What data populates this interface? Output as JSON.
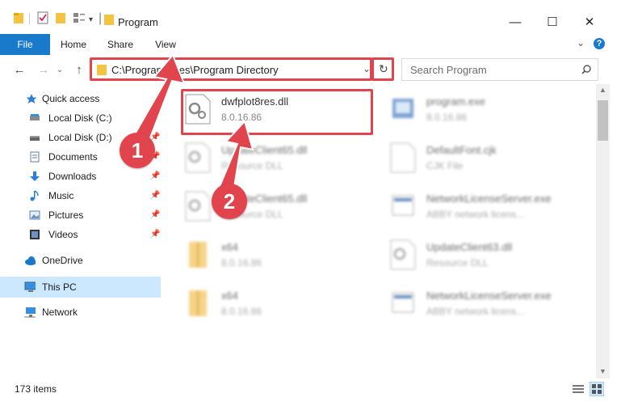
{
  "window": {
    "title": "Program",
    "minimize": "—",
    "maximize": "☐",
    "close": "✕"
  },
  "ribbon": {
    "tabs": [
      "File",
      "Home",
      "Share",
      "View"
    ]
  },
  "address": {
    "path": "C:\\Program Files\\Program Directory",
    "search_placeholder": "Search Program"
  },
  "sidebar": {
    "items": [
      {
        "label": "Quick access",
        "icon": "star-icon",
        "pinned": false
      },
      {
        "label": "Local Disk (C:)",
        "icon": "drive-icon",
        "pinned": true
      },
      {
        "label": "Local Disk (D:)",
        "icon": "drive-icon",
        "pinned": true
      },
      {
        "label": "Documents",
        "icon": "documents-icon",
        "pinned": true
      },
      {
        "label": "Downloads",
        "icon": "download-icon",
        "pinned": true
      },
      {
        "label": "Music",
        "icon": "music-icon",
        "pinned": true
      },
      {
        "label": "Pictures",
        "icon": "pictures-icon",
        "pinned": true
      },
      {
        "label": "Videos",
        "icon": "videos-icon",
        "pinned": true
      },
      {
        "label": "OneDrive",
        "icon": "cloud-icon",
        "pinned": false
      },
      {
        "label": "This PC",
        "icon": "computer-icon",
        "pinned": false,
        "selected": true
      },
      {
        "label": "Network",
        "icon": "network-icon",
        "pinned": false
      }
    ]
  },
  "files": [
    {
      "name": "dwfplot8res.dll",
      "sub": "8.0.16.86",
      "type": "dll",
      "highlighted": true
    },
    {
      "name": "program.exe",
      "sub": "8.0.16.86",
      "type": "exe"
    },
    {
      "name": "UpdateClient65.dll",
      "sub": "Resource DLL",
      "type": "dll"
    },
    {
      "name": "DefaultFont.cjk",
      "sub": "CJK File",
      "type": "file"
    },
    {
      "name": "UpdateClient65.dll",
      "sub": "Resource DLL",
      "type": "dll"
    },
    {
      "name": "NetworkLicenseServer.exe",
      "sub": "ABBY network licens...",
      "type": "exe"
    },
    {
      "name": "x64",
      "sub": "8.0.16.86",
      "type": "folder"
    },
    {
      "name": "UpdateClient63.dll",
      "sub": "Resource DLL",
      "type": "dll"
    },
    {
      "name": "x64",
      "sub": "8.0.16.86",
      "type": "folder"
    },
    {
      "name": "NetworkLicenseServer.exe",
      "sub": "ABBY network licens...",
      "type": "exe"
    }
  ],
  "status": {
    "item_count": "173 items"
  },
  "callouts": [
    "1",
    "2"
  ],
  "colors": {
    "accent": "#1979ca",
    "highlight": "#e1444c",
    "selected_nav": "#cce8ff"
  }
}
